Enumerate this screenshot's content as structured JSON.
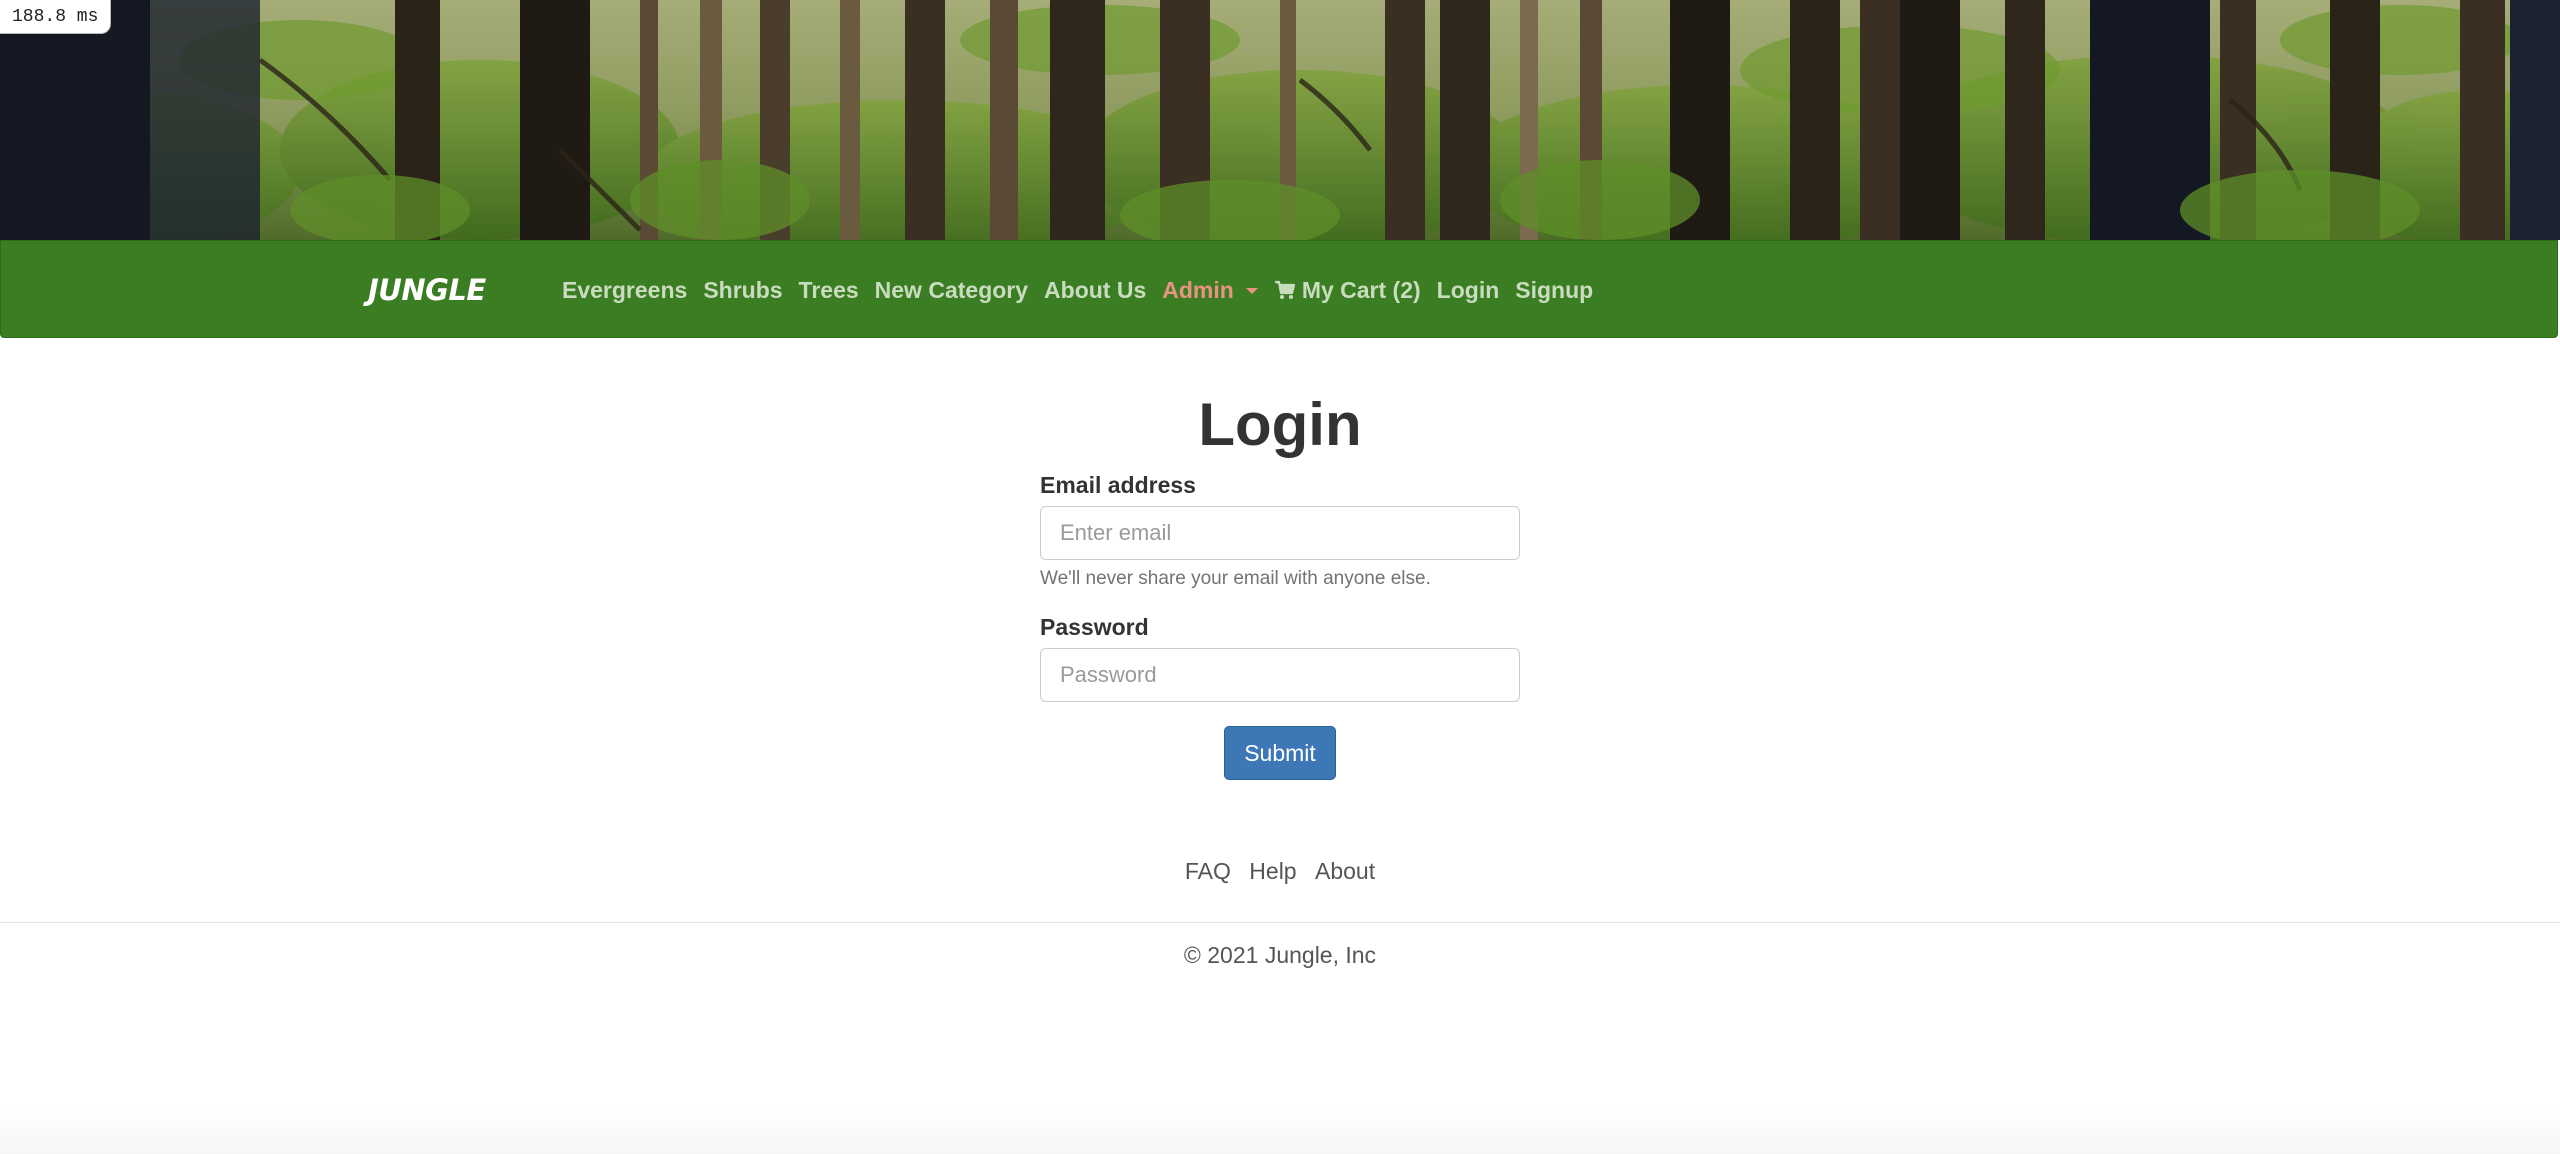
{
  "perf_badge": "188.8 ms",
  "nav": {
    "brand": "JUNGLE",
    "links": [
      "Evergreens",
      "Shrubs",
      "Trees",
      "New Category",
      "About Us"
    ],
    "admin_label": "Admin",
    "cart_label": "My Cart (2)",
    "login_label": "Login",
    "signup_label": "Signup"
  },
  "login": {
    "title": "Login",
    "email_label": "Email address",
    "email_placeholder": "Enter email",
    "email_help": "We'll never share your email with anyone else.",
    "password_label": "Password",
    "password_placeholder": "Password",
    "submit_label": "Submit"
  },
  "footer": {
    "links": [
      "FAQ",
      "Help",
      "About"
    ],
    "copyright": "© 2021 Jungle, Inc"
  },
  "colors": {
    "navbar": "#3a7d22",
    "nav_link": "#c9dcbf",
    "admin_link": "#e89383",
    "submit_button": "#3d77b5"
  },
  "icons": {
    "cart": "shopping-cart-icon",
    "admin_dropdown": "caret-down-icon"
  }
}
